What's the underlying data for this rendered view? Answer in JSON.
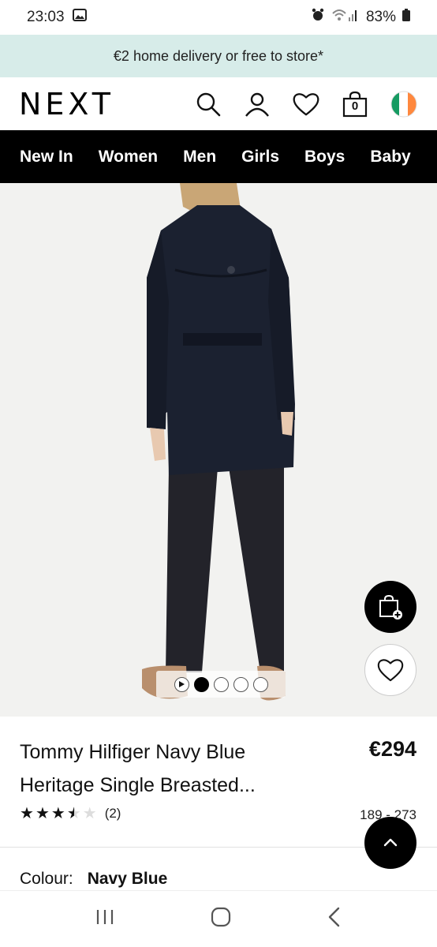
{
  "status_bar": {
    "time": "23:03",
    "battery": "83%"
  },
  "promo": {
    "text": "€2 home delivery or free to store*"
  },
  "header": {
    "logo": "NEXT",
    "bag_count": "0"
  },
  "nav": {
    "items": [
      "New In",
      "Women",
      "Men",
      "Girls",
      "Boys",
      "Baby"
    ]
  },
  "gallery": {
    "slide_count": 4,
    "active_slide": 1
  },
  "product": {
    "title": "Tommy Hilfiger Navy Blue Heritage Single Breasted...",
    "price": "€294",
    "rating": 3.5,
    "rating_count": "(2)",
    "price_range": "189 - 273",
    "colour_label": "Colour:",
    "colour_value": "Navy Blue"
  },
  "colors": {
    "promo_bg": "#d7ece9",
    "nav_bg": "#000000",
    "coat": "#1b2130"
  },
  "icons": [
    "search-icon",
    "account-icon",
    "heart-icon",
    "bag-icon",
    "ireland-flag-icon",
    "add-to-bag-icon",
    "chevron-up-icon"
  ]
}
